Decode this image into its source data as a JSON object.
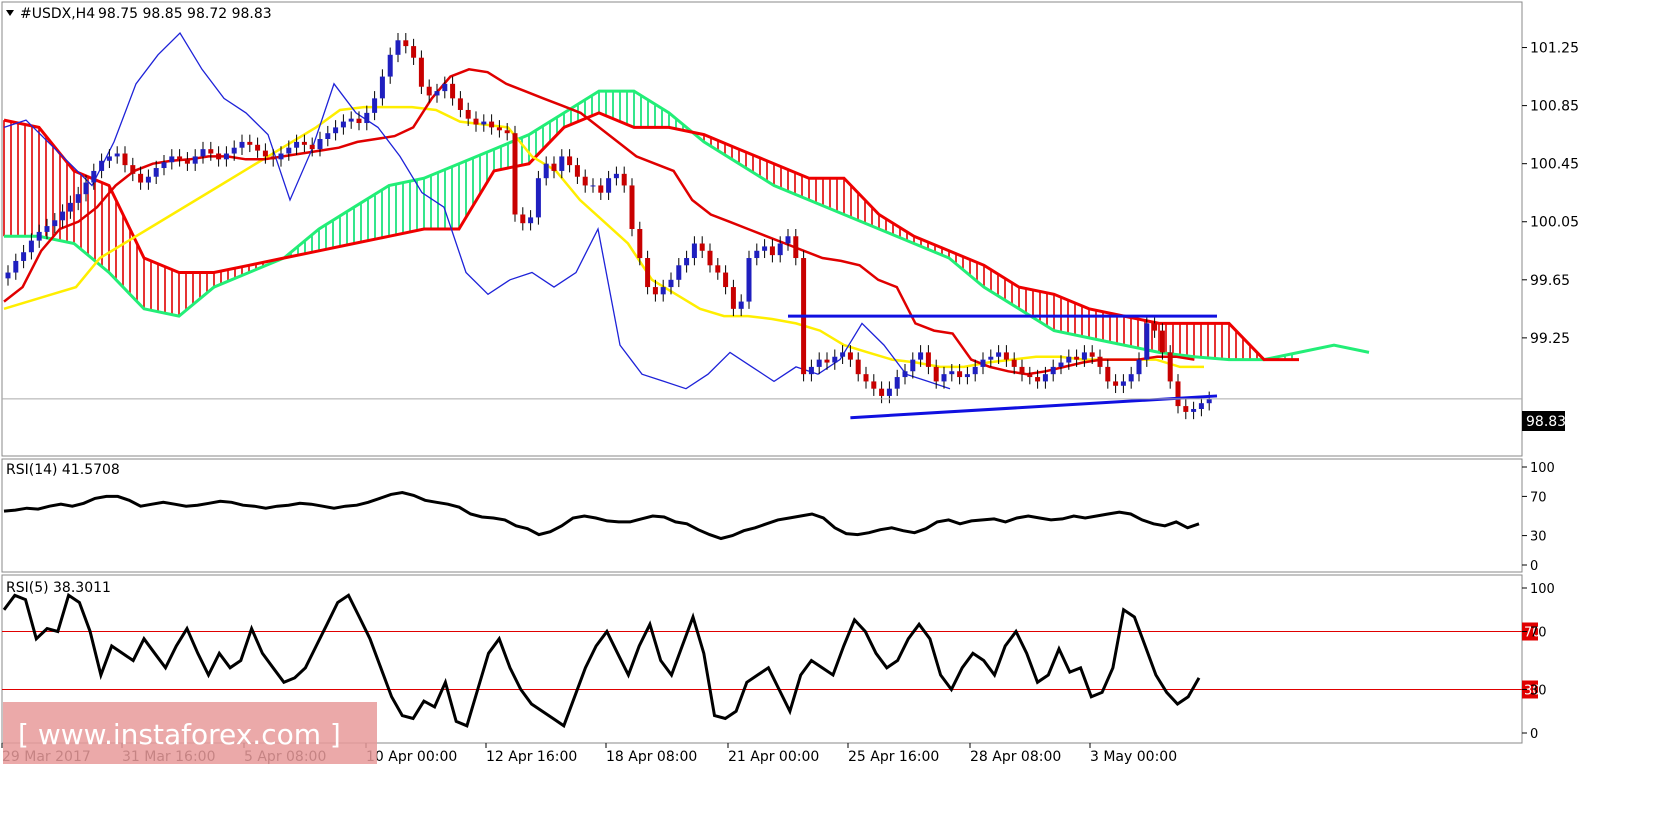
{
  "header": {
    "symbol_label": "#USDX,H4",
    "ohlc_text": "98.75 98.85 98.72 98.83",
    "current_price": "98.83"
  },
  "panels": {
    "rsi14_label": "RSI(14) 41.5708",
    "rsi5_label": "RSI(5) 38.3011",
    "rsi14_ticks": [
      "100",
      "70",
      "30",
      "0"
    ],
    "rsi5_ticks": [
      "100",
      "70",
      "30",
      "0"
    ],
    "rsi5_level_labels": [
      "70",
      "30"
    ]
  },
  "watermark": {
    "text": "[ www.instaforex.com ]"
  },
  "colors": {
    "bull_candle": "#1f1fbf",
    "bear_candle": "#c80000",
    "tenkan": "#e00000",
    "kijun": "#ffee00",
    "chikou": "#1e22d8",
    "senkou_a": "#22ee77",
    "senkou_b": "#ee0000",
    "cloud_bull": "#00e070",
    "cloud_bear": "#e00000",
    "trendline": "#1010e0",
    "rsi_line": "#000000",
    "rsi_level": "#e00000"
  },
  "chart_data": [
    {
      "type": "candlestick",
      "title": "#USDX,H4",
      "indicator": "Ichimoku Kinko Hyo",
      "ylim": [
        98.45,
        101.55
      ],
      "y_ticks": [
        "101.25",
        "100.85",
        "100.45",
        "100.05",
        "99.65",
        "99.25"
      ],
      "x_tick_labels": [
        "29 Mar 2017",
        "31 Mar 16:00",
        "5 Apr 08:00",
        "10 Apr 00:00",
        "12 Apr 16:00",
        "18 Apr 08:00",
        "21 Apr 00:00",
        "25 Apr 16:00",
        "28 Apr 08:00",
        "3 May 00:00"
      ],
      "close": [
        99.7,
        99.78,
        99.84,
        99.92,
        99.98,
        100.02,
        100.06,
        100.12,
        100.18,
        100.24,
        100.32,
        100.4,
        100.47,
        100.5,
        100.52,
        100.44,
        100.38,
        100.32,
        100.36,
        100.42,
        100.46,
        100.5,
        100.48,
        100.45,
        100.5,
        100.55,
        100.52,
        100.48,
        100.52,
        100.56,
        100.6,
        100.58,
        100.54,
        100.5,
        100.48,
        100.52,
        100.56,
        100.6,
        100.58,
        100.55,
        100.62,
        100.66,
        100.7,
        100.74,
        100.76,
        100.73,
        100.8,
        100.9,
        101.05,
        101.2,
        101.3,
        101.26,
        101.18,
        100.98,
        100.92,
        100.95,
        101.0,
        100.9,
        100.82,
        100.76,
        100.72,
        100.74,
        100.7,
        100.68,
        100.66,
        100.1,
        100.04,
        100.08,
        100.35,
        100.45,
        100.4,
        100.5,
        100.44,
        100.36,
        100.3,
        100.3,
        100.25,
        100.35,
        100.38,
        100.3,
        100.0,
        99.8,
        99.6,
        99.55,
        99.6,
        99.65,
        99.75,
        99.8,
        99.9,
        99.85,
        99.75,
        99.7,
        99.6,
        99.45,
        99.5,
        99.8,
        99.85,
        99.88,
        99.82,
        99.9,
        99.95,
        99.8,
        99.0,
        99.05,
        99.1,
        99.08,
        99.12,
        99.15,
        99.1,
        99.0,
        98.95,
        98.9,
        98.85,
        98.9,
        98.98,
        99.02,
        99.1,
        99.15,
        99.05,
        98.95,
        99.0,
        99.02,
        98.98,
        99.0,
        99.05,
        99.1,
        99.12,
        99.15,
        99.1,
        99.05,
        99.0,
        98.98,
        98.95,
        99.0,
        99.05,
        99.08,
        99.12,
        99.1,
        99.15,
        99.12,
        99.05,
        98.95,
        98.92,
        98.95,
        99.0,
        99.1,
        99.35,
        99.3,
        99.15,
        98.95,
        98.78,
        98.74,
        98.76,
        98.8,
        98.83
      ],
      "series": [
        {
          "name": "Tenkan-sen",
          "values": [
            99.5,
            99.6,
            99.85,
            100.0,
            100.05,
            100.15,
            100.3,
            100.4,
            100.45,
            100.47,
            100.48,
            100.5,
            100.5,
            100.48,
            100.48,
            100.5,
            100.52,
            100.54,
            100.56,
            100.6,
            100.62,
            100.64,
            100.7,
            100.9,
            101.05,
            101.1,
            101.08,
            101.0,
            100.95,
            100.9,
            100.85,
            100.8,
            100.7,
            100.6,
            100.5,
            100.45,
            100.4,
            100.2,
            100.1,
            100.05,
            100.0,
            99.95,
            99.9,
            99.85,
            99.8,
            99.78,
            99.75,
            99.65,
            99.6,
            99.35,
            99.3,
            99.28,
            99.1,
            99.05,
            99.02,
            99.0,
            99.02,
            99.05,
            99.08,
            99.1,
            99.1,
            99.1,
            99.12,
            99.12,
            99.1
          ]
        },
        {
          "name": "Kijun-sen",
          "values": [
            99.45,
            99.5,
            99.55,
            99.6,
            99.8,
            99.9,
            100.0,
            100.1,
            100.2,
            100.3,
            100.4,
            100.5,
            100.6,
            100.7,
            100.82,
            100.84,
            100.84,
            100.84,
            100.82,
            100.74,
            100.72,
            100.7,
            100.5,
            100.4,
            100.2,
            100.05,
            99.9,
            99.65,
            99.55,
            99.45,
            99.4,
            99.4,
            99.38,
            99.35,
            99.3,
            99.2,
            99.15,
            99.1,
            99.08,
            99.05,
            99.05,
            99.08,
            99.1,
            99.12,
            99.12,
            99.1,
            99.1,
            99.1,
            99.1,
            99.05,
            99.05
          ]
        },
        {
          "name": "Chikou Span",
          "values": [
            100.7,
            100.75,
            100.6,
            100.45,
            100.3,
            100.6,
            101.0,
            101.2,
            101.35,
            101.1,
            100.9,
            100.8,
            100.65,
            100.2,
            100.55,
            101.0,
            100.8,
            100.7,
            100.5,
            100.25,
            100.15,
            99.7,
            99.55,
            99.65,
            99.7,
            99.6,
            99.7,
            100.0,
            99.2,
            99.0,
            98.95,
            98.9,
            99.0,
            99.15,
            99.05,
            98.95,
            99.05,
            99.0,
            99.1,
            99.35,
            99.2,
            99.0,
            98.95,
            98.9
          ]
        },
        {
          "name": "Senkou Span A",
          "values": [
            99.95,
            99.95,
            99.9,
            99.7,
            99.45,
            99.4,
            99.6,
            99.7,
            99.8,
            100.0,
            100.15,
            100.3,
            100.35,
            100.45,
            100.55,
            100.65,
            100.8,
            100.95,
            100.95,
            100.8,
            100.6,
            100.45,
            100.3,
            100.2,
            100.1,
            100.0,
            99.9,
            99.8,
            99.6,
            99.45,
            99.3,
            99.25,
            99.2,
            99.15,
            99.12,
            99.1,
            99.1,
            99.15,
            99.2,
            99.15
          ]
        },
        {
          "name": "Senkou Span B",
          "values": [
            100.75,
            100.7,
            100.4,
            100.3,
            99.8,
            99.7,
            99.7,
            99.75,
            99.8,
            99.85,
            99.9,
            99.95,
            100.0,
            100.0,
            100.4,
            100.45,
            100.7,
            100.8,
            100.7,
            100.7,
            100.65,
            100.55,
            100.45,
            100.35,
            100.35,
            100.1,
            99.95,
            99.85,
            99.75,
            99.6,
            99.55,
            99.45,
            99.4,
            99.35,
            99.35,
            99.35,
            99.1,
            99.1
          ]
        }
      ],
      "annotations": [
        {
          "type": "horizontal_trendline",
          "value": 99.4
        },
        {
          "type": "rising_trendline",
          "start": 98.7,
          "end": 98.85
        },
        {
          "type": "price_line",
          "value": 98.83
        }
      ],
      "grid": false
    },
    {
      "type": "line",
      "title": "RSI(14) 41.5708",
      "ylim": [
        0,
        100
      ],
      "y_ticks": [
        100,
        70,
        30,
        0
      ],
      "values": [
        55,
        56,
        58,
        57,
        60,
        62,
        60,
        63,
        68,
        70,
        70,
        66,
        60,
        62,
        64,
        62,
        60,
        61,
        63,
        65,
        64,
        61,
        60,
        58,
        60,
        61,
        63,
        62,
        60,
        58,
        60,
        61,
        64,
        68,
        72,
        74,
        71,
        66,
        64,
        62,
        59,
        52,
        49,
        48,
        46,
        40,
        37,
        31,
        34,
        40,
        48,
        50,
        48,
        45,
        44,
        44,
        47,
        50,
        49,
        44,
        42,
        36,
        31,
        27,
        30,
        35,
        38,
        42,
        46,
        48,
        50,
        52,
        48,
        38,
        32,
        31,
        33,
        36,
        38,
        35,
        33,
        37,
        44,
        46,
        42,
        45,
        46,
        47,
        44,
        48,
        50,
        48,
        46,
        47,
        50,
        48,
        50,
        52,
        54,
        52,
        46,
        42,
        40,
        44,
        38,
        42
      ]
    },
    {
      "type": "line",
      "title": "RSI(5) 38.3011",
      "ylim": [
        0,
        100
      ],
      "y_ticks": [
        100,
        70,
        30,
        0
      ],
      "reference_lines": [
        70,
        30
      ],
      "values": [
        85,
        95,
        92,
        65,
        72,
        70,
        95,
        90,
        70,
        40,
        60,
        55,
        50,
        65,
        55,
        45,
        60,
        72,
        55,
        40,
        55,
        45,
        50,
        72,
        55,
        45,
        35,
        38,
        45,
        60,
        75,
        90,
        95,
        80,
        65,
        45,
        25,
        12,
        10,
        22,
        18,
        35,
        8,
        5,
        30,
        55,
        65,
        45,
        30,
        20,
        15,
        10,
        5,
        25,
        45,
        60,
        70,
        55,
        40,
        60,
        75,
        50,
        40,
        60,
        80,
        55,
        12,
        10,
        15,
        35,
        40,
        45,
        30,
        15,
        40,
        50,
        45,
        40,
        60,
        78,
        70,
        55,
        45,
        50,
        65,
        75,
        65,
        40,
        30,
        45,
        55,
        50,
        40,
        60,
        70,
        55,
        35,
        40,
        58,
        42,
        45,
        25,
        28,
        45,
        85,
        80,
        60,
        40,
        28,
        20,
        25,
        38
      ]
    }
  ]
}
